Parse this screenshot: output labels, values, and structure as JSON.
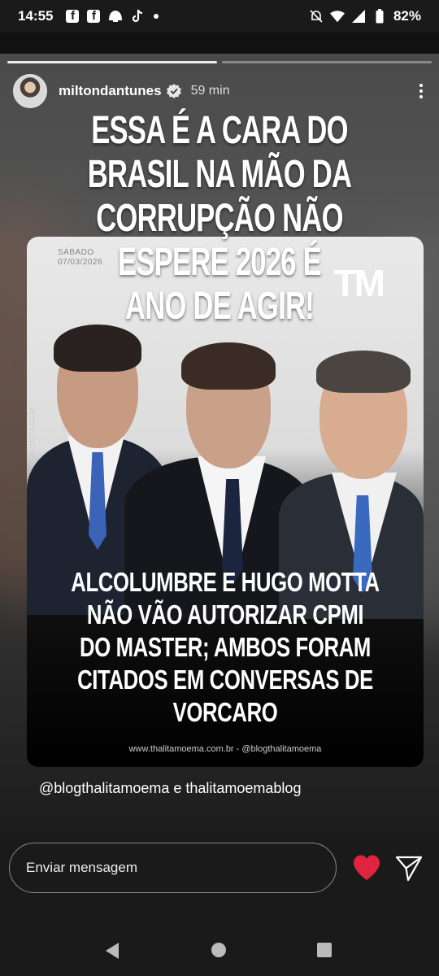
{
  "status_bar": {
    "time": "14:55",
    "battery": "82%",
    "icons_left": [
      "facebook-icon",
      "facebook-icon",
      "shell-icon",
      "tiktok-icon",
      "dot-icon"
    ],
    "icons_right": [
      "mute-icon",
      "wifi-icon",
      "signal-icon",
      "battery-icon"
    ]
  },
  "story": {
    "username": "miltondantunes",
    "time_ago": "59 min",
    "progress_segments": 2,
    "progress_done": 1,
    "overlay_text": "ESSA É A CARA DO BRASIL NA MÃO DA CORRUPÇÃO NÃO ESPERE 2026 É ANO DE AGIR!",
    "mention": "@blogthalitamoema e thalitamoemablog"
  },
  "post": {
    "date_line1": "SÁBADO",
    "date_line2": "07/03/2026",
    "logo": "TM",
    "vertical_label": "MONTAGEM",
    "headline": "ALCOLUMBRE E HUGO MOTTA NÃO VÃO AUTORIZAR CPMI DO MASTER; AMBOS FORAM CITADOS EM CONVERSAS DE VORCARO",
    "footer": "www.thalitamoema.com.br - @blogthalitamoema"
  },
  "reply": {
    "placeholder": "Enviar mensagem"
  },
  "colors": {
    "heart": "#e0243f",
    "bar_bg": "#1a1a1a"
  }
}
